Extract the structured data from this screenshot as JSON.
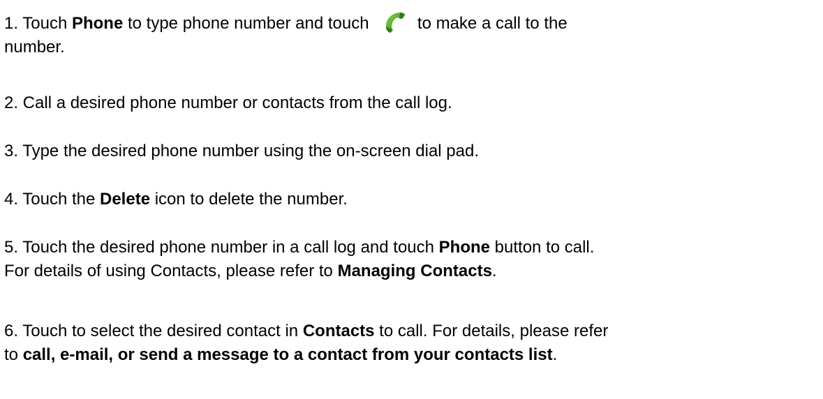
{
  "steps": [
    {
      "number": "1.",
      "line1_part1": " Touch ",
      "line1_bold1": "Phone",
      "line1_part2": " to type phone number and touch ",
      "icon": "green-phone-handset-icon",
      "line1_part3": " to make a call to the",
      "line2": "number."
    },
    {
      "number": "2.",
      "text": " Call a desired phone number or contacts from the call log."
    },
    {
      "number": "3.",
      "text": " Type the desired phone number using the on-screen dial pad."
    },
    {
      "number": "4.",
      "part1": " Touch the ",
      "bold1": "Delete",
      "part2": " icon to delete the number."
    },
    {
      "number": "5.",
      "line1_part1": " Touch the desired phone number in a call log and touch ",
      "line1_bold1": "Phone",
      "line1_part2": " button to call.",
      "line2_part1": " For details of using Contacts, please refer to ",
      "line2_bold1": "Managing Contacts",
      "line2_part2": "."
    },
    {
      "number": "6.",
      "line1_part1": " Touch to select the desired contact in ",
      "line1_bold1": "Contacts",
      "line1_part2": " to call. For details, please refer",
      "line2_part1": "to ",
      "line2_bold1": "call, e-mail, or send a message to a contact from your contacts list",
      "line2_part2": "."
    }
  ],
  "colors": {
    "text": "#000000",
    "background": "#ffffff",
    "phone_icon_green": "#3a9a1e"
  }
}
